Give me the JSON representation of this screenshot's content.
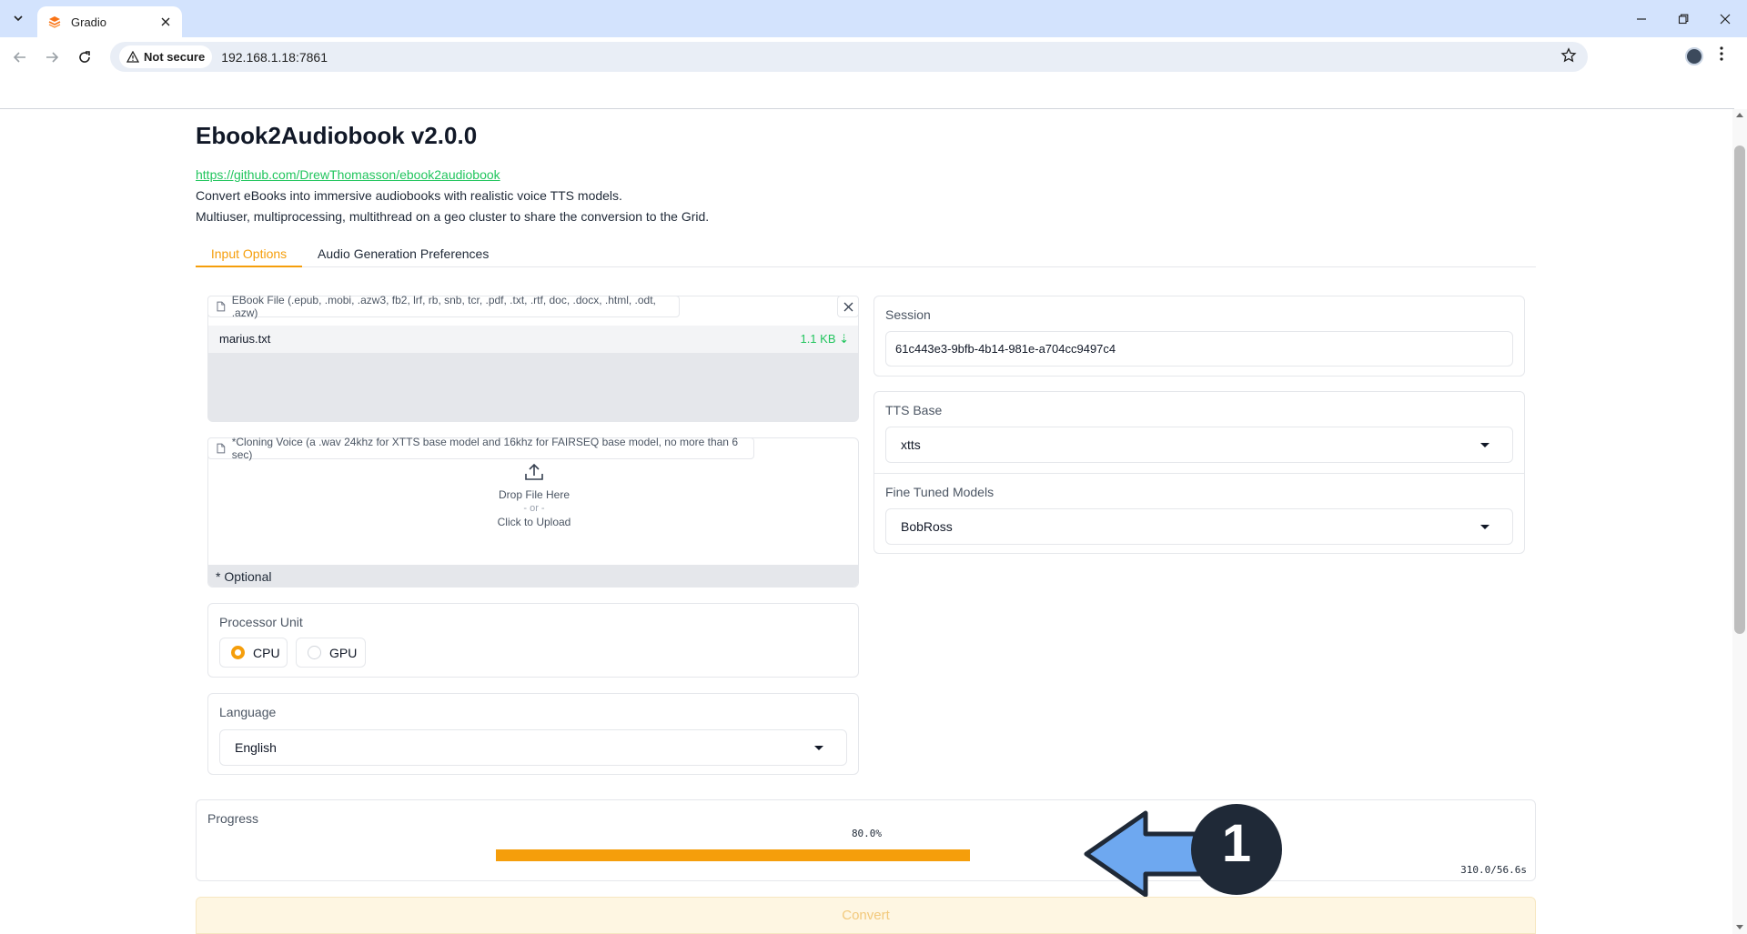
{
  "browser": {
    "tab_title": "Gradio",
    "security_label": "Not secure",
    "url": "192.168.1.18:7861"
  },
  "page": {
    "title": "Ebook2Audiobook v2.0.0",
    "repo_link": "https://github.com/DrewThomasson/ebook2audiobook",
    "description_1": "Convert eBooks into immersive audiobooks with realistic voice TTS models.",
    "description_2": "Multiuser, multiprocessing, multithread on a geo cluster to share the conversion to the Grid."
  },
  "tabs": [
    {
      "label": "Input Options",
      "active": true
    },
    {
      "label": "Audio Generation Preferences",
      "active": false
    }
  ],
  "ebook_file": {
    "label": "EBook File (.epub, .mobi, .azw3, fb2, lrf, rb, snb, tcr, .pdf, .txt, .rtf, doc, .docx, .html, .odt, .azw)",
    "file_name": "marius.txt",
    "file_size": "1.1 KB ⇣"
  },
  "voice_file": {
    "label": "*Cloning Voice (a .wav 24khz for XTTS base model and 16khz for FAIRSEQ base model, no more than 6 sec)",
    "drop_text": "Drop File Here",
    "or_text": "- or -",
    "click_text": "Click to Upload",
    "footer": "* Optional"
  },
  "processor": {
    "label": "Processor Unit",
    "options": [
      {
        "label": "CPU",
        "selected": true
      },
      {
        "label": "GPU",
        "selected": false
      }
    ]
  },
  "language": {
    "label": "Language",
    "value": "English"
  },
  "session": {
    "label": "Session",
    "value": "61c443e3-9bfb-4b14-981e-a704cc9497c4"
  },
  "tts_base": {
    "label": "TTS Base",
    "value": "xtts"
  },
  "fine_tuned": {
    "label": "Fine Tuned Models",
    "value": "BobRoss"
  },
  "progress": {
    "label": "Progress",
    "percent_text": "80.0%",
    "value": 0.8,
    "timing": "310.0/56.6s"
  },
  "annotation": {
    "step_number": "1",
    "arrow_color": "#6ea8f0",
    "badge_color": "#1f2937"
  },
  "convert": {
    "label": "Convert"
  },
  "colors": {
    "accent": "#f59e0b",
    "link": "#22c55e",
    "tab_strip": "#d3e3fd"
  }
}
